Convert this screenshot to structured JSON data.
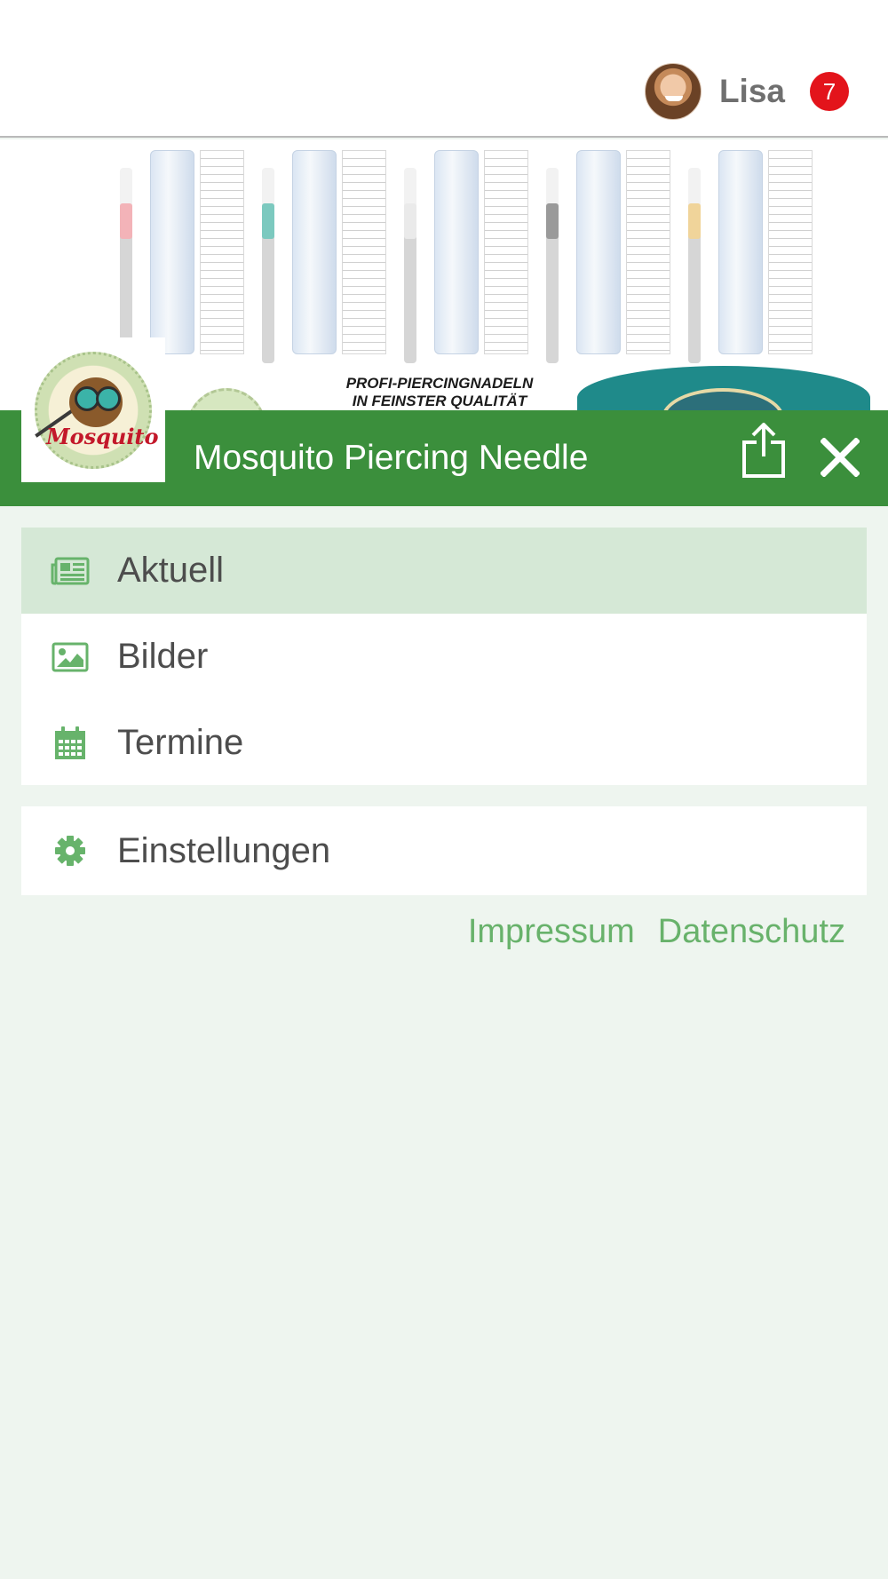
{
  "topbar": {
    "user_name": "Lisa",
    "notification_count": "7"
  },
  "banner": {
    "tagline_line1": "PROFI-PIERCINGNADELN",
    "tagline_line2": "IN FEINSTER QUALITÄT"
  },
  "header": {
    "title": "Mosquito Piercing Needle",
    "logo_text": "Mosquito"
  },
  "menu": {
    "items": [
      {
        "label": "Aktuell",
        "icon": "newspaper-icon",
        "active": true
      },
      {
        "label": "Bilder",
        "icon": "image-icon",
        "active": false
      },
      {
        "label": "Termine",
        "icon": "calendar-icon",
        "active": false
      }
    ],
    "settings": {
      "label": "Einstellungen",
      "icon": "gear-icon"
    }
  },
  "footer": {
    "impressum": "Impressum",
    "datenschutz": "Datenschutz"
  },
  "colors": {
    "header_green": "#3b8f3c",
    "active_row": "#d5e8d6",
    "icon_green": "#67b36b",
    "badge_red": "#e3141b",
    "page_bg": "#eef5ef"
  }
}
